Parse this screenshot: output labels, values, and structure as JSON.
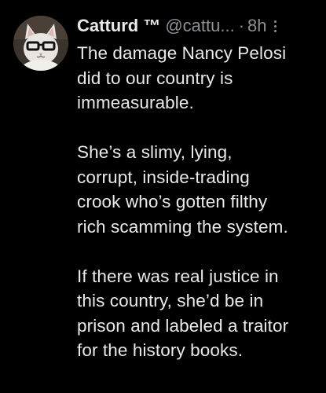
{
  "tweet": {
    "display_name": "Catturd ™",
    "handle": "@cattu...",
    "separator": "·",
    "time": "8h",
    "avatar_icon": "cat-with-glasses-avatar",
    "more_icon": "more-options-icon",
    "paragraphs": [
      {
        "lines": [
          "The damage Nancy Pelosi",
          "did to our country is",
          "immeasurable."
        ]
      },
      {
        "lines": [
          "She’s a slimy, lying,",
          "corrupt, inside-trading",
          "crook who’s gotten filthy",
          "rich scamming the system."
        ]
      },
      {
        "lines": [
          "If there was real justice in",
          "this country, she’d be in",
          "prison and labeled a traitor",
          "for the history books."
        ]
      }
    ]
  },
  "colors": {
    "background": "#000000",
    "primary_text": "#e7e9ea",
    "secondary_text": "#8b9196"
  }
}
